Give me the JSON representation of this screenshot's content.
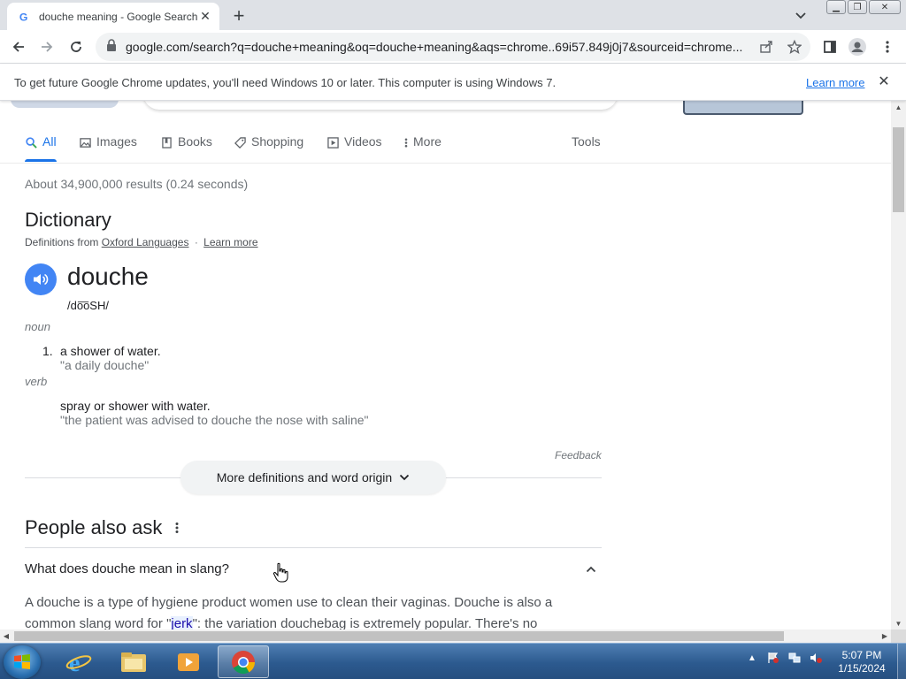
{
  "browser": {
    "tab_title": "douche meaning - Google Search",
    "new_tab": "+",
    "url": "google.com/search?q=douche+meaning&oq=douche+meaning&aqs=chrome..69i57.849j0j7&sourceid=chrome...",
    "window_buttons": [
      "minimize",
      "restore",
      "close"
    ]
  },
  "infobar": {
    "message": "To get future Google Chrome updates, you'll need Windows 10 or later. This computer is using Windows 7.",
    "link": "Learn more",
    "close": "✕"
  },
  "search_tabs": {
    "all": "All",
    "images": "Images",
    "books": "Books",
    "shopping": "Shopping",
    "videos": "Videos",
    "more": "More",
    "tools": "Tools"
  },
  "results_stats": "About 34,900,000 results (0.24 seconds)",
  "dictionary": {
    "title": "Dictionary",
    "definitions_from": "Definitions from",
    "source": "Oxford Languages",
    "learn_more": "Learn more",
    "word": "douche",
    "phonetic": "/do͞oSH/",
    "noun_label": "noun",
    "noun_def_number": "1.",
    "noun_def": "a shower of water.",
    "noun_example": "\"a daily douche\"",
    "verb_label": "verb",
    "verb_def": "spray or shower with water.",
    "verb_example": "\"the patient was advised to douche the nose with saline\"",
    "feedback": "Feedback",
    "more_button": "More definitions and word origin"
  },
  "people_also_ask": {
    "title": "People also ask",
    "question": "What does douche mean in slang?",
    "answer_part1": "A douche is a type of hygiene product women use to clean their vaginas. Douche is also a common slang word for \"",
    "answer_highlight": "jerk",
    "answer_part2": "\": the variation douchebag is extremely popular. There's no"
  },
  "taskbar": {
    "time": "5:07 PM",
    "date": "1/15/2024"
  },
  "colors": {
    "accent": "#1a73e8",
    "speaker": "#4285f4",
    "taskbar": "#2c5a8f"
  }
}
